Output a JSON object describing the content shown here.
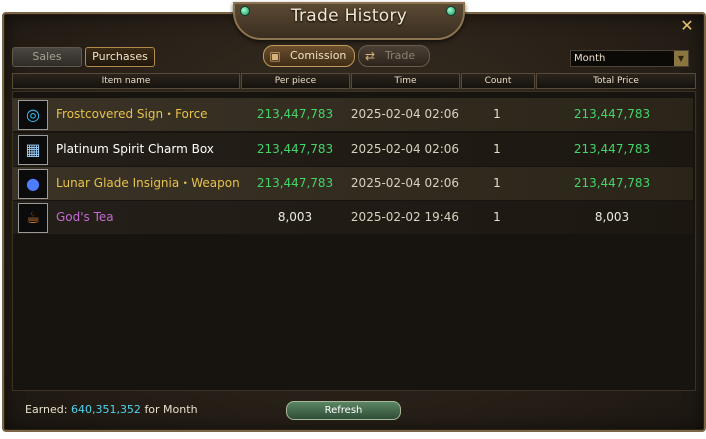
{
  "window": {
    "title": "Trade History",
    "close_icon": "close-icon"
  },
  "tabs": {
    "sales": "Sales",
    "purchases": "Purchases",
    "active": "purchases"
  },
  "filters": {
    "commission": {
      "label": "Comission",
      "icon": "chest-icon",
      "active": true
    },
    "trade": {
      "label": "Trade",
      "icon": "trade-icon",
      "active": false
    }
  },
  "period": {
    "selected": "Month"
  },
  "columns": {
    "item": "Item name",
    "per_piece": "Per piece",
    "time": "Time",
    "count": "Count",
    "total": "Total Price"
  },
  "rows": [
    {
      "icon": "ring-icon",
      "name": "Frostcovered Sign・Force",
      "name_color": "#e8c24b",
      "per_piece": "213,447,783",
      "time": "2025-02-04 02:06",
      "count": "1",
      "total": "213,447,783"
    },
    {
      "icon": "charm-box-icon",
      "name": "Platinum Spirit Charm Box",
      "name_color": "#ffffff",
      "per_piece": "213,447,783",
      "time": "2025-02-04 02:06",
      "count": "1",
      "total": "213,447,783"
    },
    {
      "icon": "orb-icon",
      "name": "Lunar Glade Insignia・Weapon",
      "name_color": "#e8c24b",
      "per_piece": "213,447,783",
      "time": "2025-02-04 02:06",
      "count": "1",
      "total": "213,447,783"
    },
    {
      "icon": "teapot-icon",
      "name": "God's Tea",
      "name_color": "#c26bd3",
      "per_piece": "8,003",
      "time": "2025-02-02 19:46",
      "count": "1",
      "total": "8,003"
    }
  ],
  "footer": {
    "earned_label": "Earned:",
    "earned_value": "640,351,352",
    "earned_suffix": "for Month",
    "refresh_label": "Refresh"
  }
}
